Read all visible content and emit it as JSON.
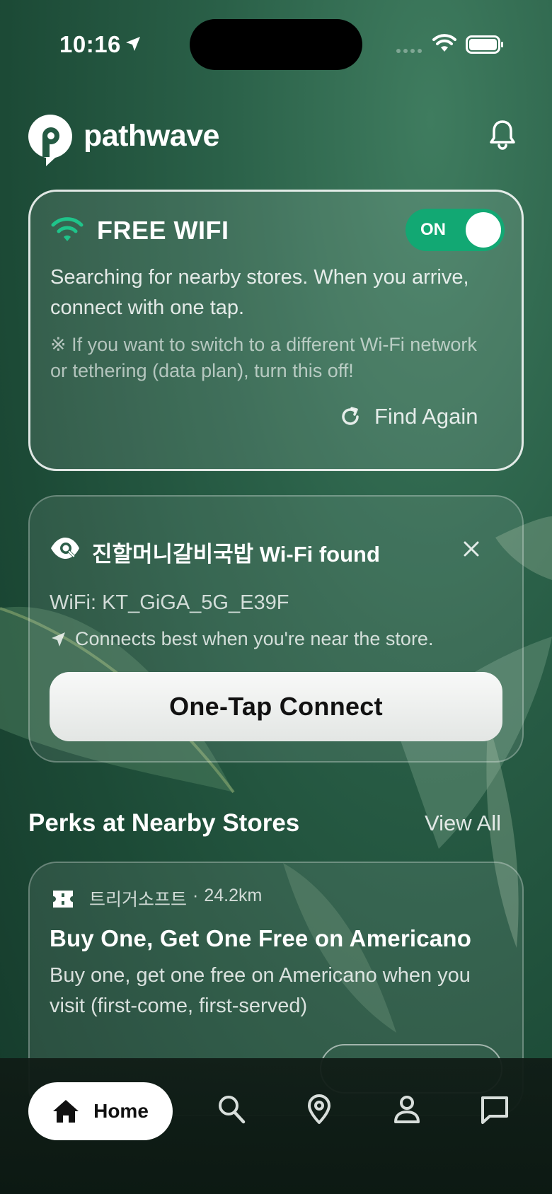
{
  "status_bar": {
    "time": "10:16"
  },
  "header": {
    "brand": "pathwave",
    "icons": {
      "logo": "pathwave-logo-icon",
      "notifications": "bell-icon"
    }
  },
  "wifi_card": {
    "title": "FREE WIFI",
    "toggle_label": "ON",
    "toggle_on": true,
    "description": "Searching for nearby stores. When you arrive, connect with one tap.",
    "note": "※ If you want to switch to a different Wi-Fi network or tethering (data plan), turn this off!",
    "find_again_label": "Find Again"
  },
  "found_card": {
    "title": "진할머니갈비국밥 Wi-Fi found",
    "ssid_line": "WiFi: KT_GiGA_5G_E39F",
    "hint": "Connects best when you're near the store.",
    "connect_label": "One-Tap Connect"
  },
  "perks_section": {
    "title": "Perks at Nearby Stores",
    "view_all_label": "View All",
    "items": [
      {
        "store": "트리거소프트",
        "separator": "·",
        "distance": "24.2km",
        "title": "Buy One, Get One Free on Americano",
        "description": "Buy one, get one free on Americano when you visit (first-come, first-served)"
      }
    ]
  },
  "bottom_nav": {
    "home_label": "Home",
    "items": [
      "home-icon",
      "search-icon",
      "map-pin-icon",
      "profile-icon",
      "chat-icon"
    ]
  },
  "colors": {
    "accent_green": "#12a873",
    "background": "#2a6048"
  }
}
